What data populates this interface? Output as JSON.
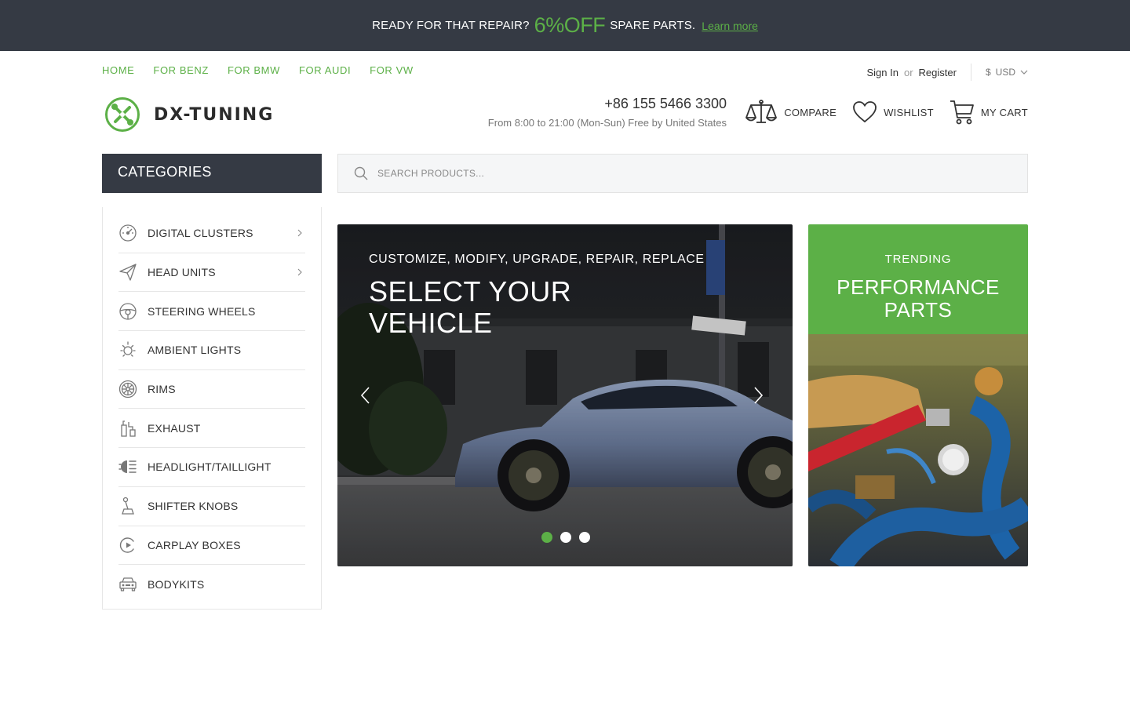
{
  "promo": {
    "text_before": "READY FOR THAT REPAIR?",
    "highlight": "6%OFF",
    "text_after": "SPARE PARTS.",
    "link": "Learn more"
  },
  "topnav": [
    "HOME",
    "FOR BENZ",
    "FOR BMW",
    "FOR AUDI",
    "FOR VW"
  ],
  "account": {
    "sign_in": "Sign In",
    "or": "or",
    "register": "Register",
    "currency_symbol": "$",
    "currency": "USD"
  },
  "logo": {
    "text": "DX-TUNING"
  },
  "contact": {
    "phone": "+86 155 5466 3300",
    "hours": "From 8:00 to 21:00 (Mon-Sun) Free by United States"
  },
  "header_buttons": {
    "compare": "COMPARE",
    "wishlist": "WISHLIST",
    "cart": "MY CART"
  },
  "categories": {
    "title": "CATEGORIES",
    "items": [
      {
        "label": "DIGITAL CLUSTERS",
        "icon": "speedometer-icon",
        "has_sub": true
      },
      {
        "label": "HEAD UNITS",
        "icon": "paper-plane-icon",
        "has_sub": true
      },
      {
        "label": "STEERING WHEELS",
        "icon": "steering-wheel-icon",
        "has_sub": false
      },
      {
        "label": "AMBIENT LIGHTS",
        "icon": "light-icon",
        "has_sub": false
      },
      {
        "label": "RIMS",
        "icon": "rim-icon",
        "has_sub": false
      },
      {
        "label": "EXHAUST",
        "icon": "exhaust-icon",
        "has_sub": false
      },
      {
        "label": "HEADLIGHT/TAILLIGHT",
        "icon": "headlight-icon",
        "has_sub": false
      },
      {
        "label": "SHIFTER KNOBS",
        "icon": "shifter-icon",
        "has_sub": false
      },
      {
        "label": "CARPLAY BOXES",
        "icon": "carplay-icon",
        "has_sub": false
      },
      {
        "label": "BODYKITS",
        "icon": "car-front-icon",
        "has_sub": false
      }
    ]
  },
  "search": {
    "placeholder": "SEARCH PRODUCTS..."
  },
  "hero": {
    "eyebrow": "CUSTOMIZE, MODIFY, UPGRADE, REPAIR, REPLACE",
    "title": "SELECT YOUR VEHICLE",
    "active_slide": 1,
    "slide_count": 3
  },
  "side_promo": {
    "eyebrow": "TRENDING",
    "title": "PERFORMANCE PARTS"
  },
  "colors": {
    "accent": "#5cb047",
    "dark": "#353a44",
    "border": "#e6e6e6"
  }
}
